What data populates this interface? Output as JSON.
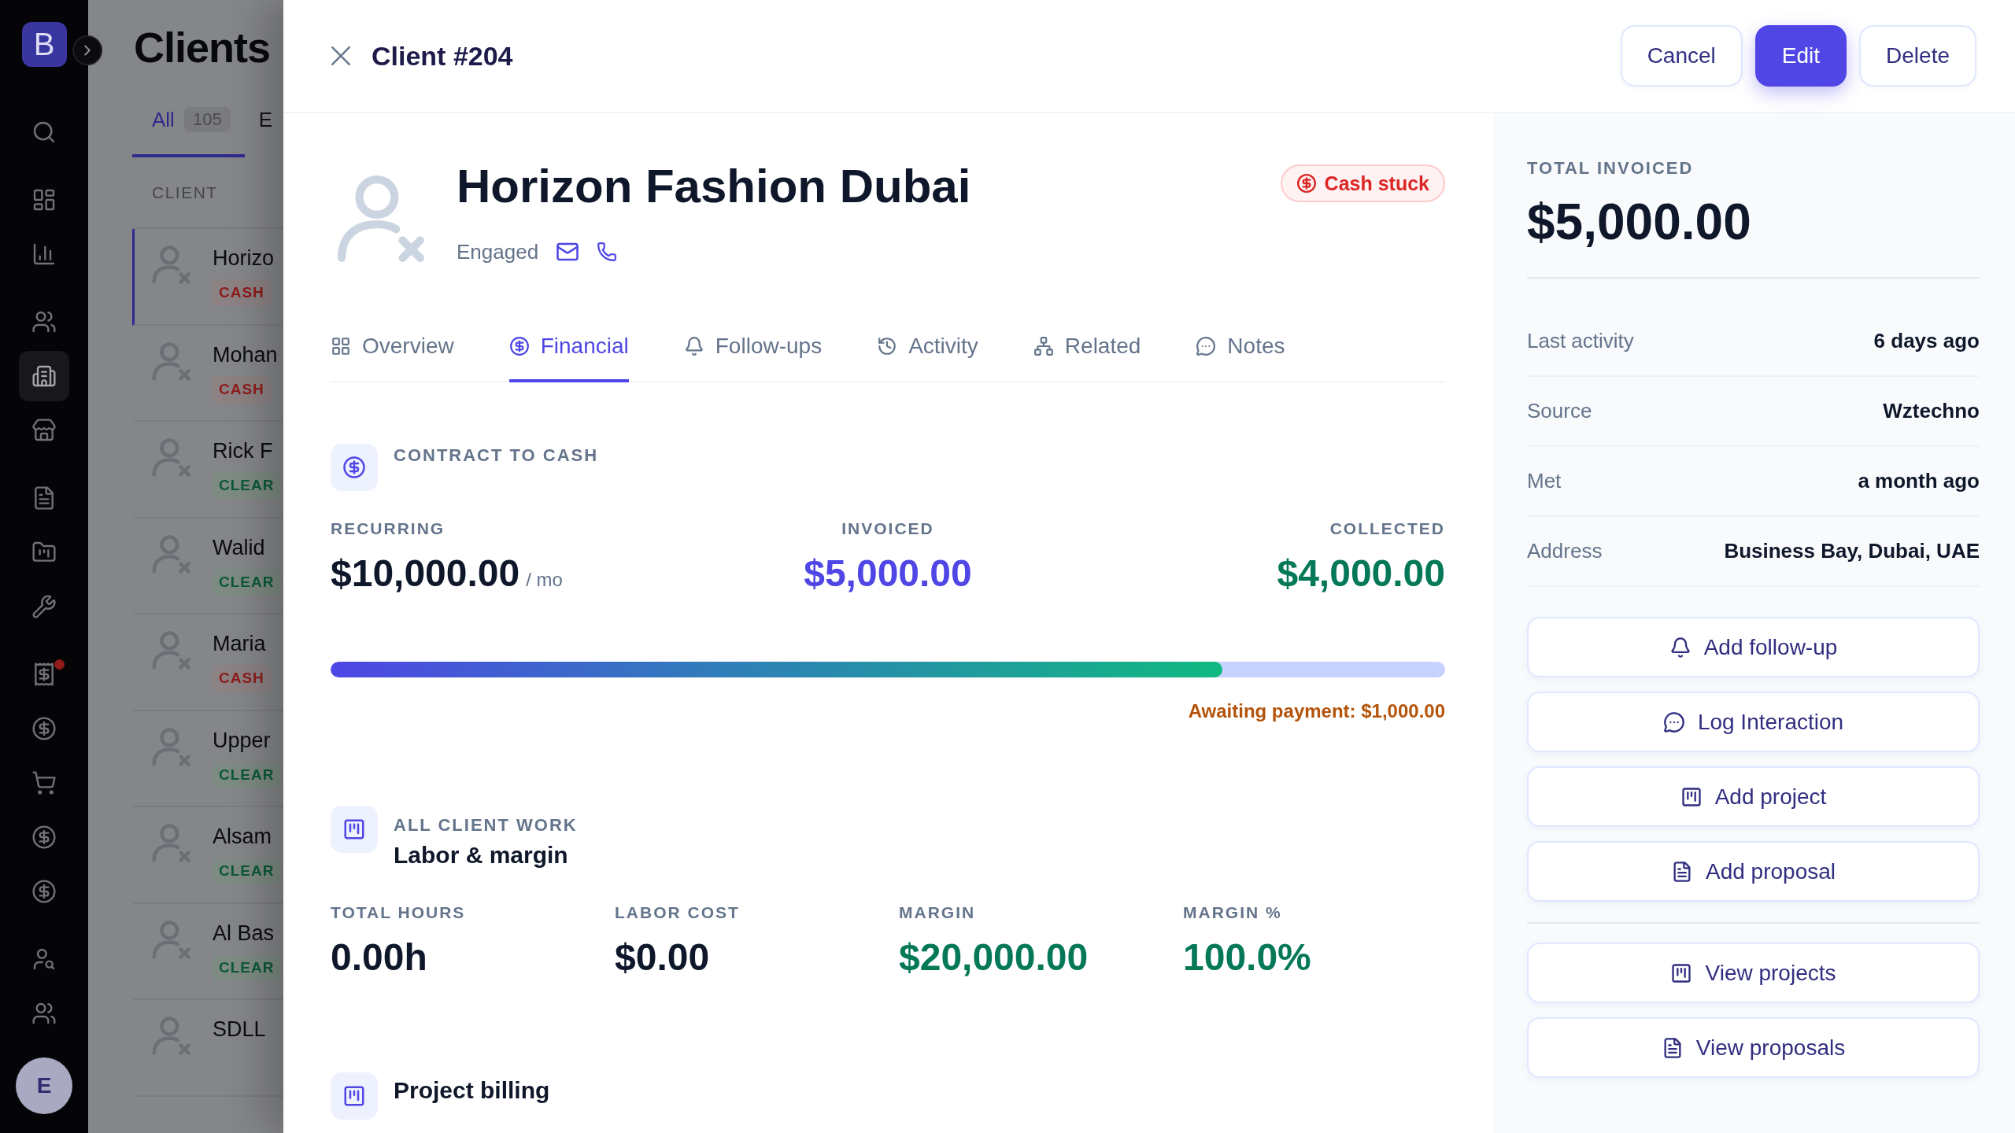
{
  "sidebar": {
    "logo": "B",
    "groups": [
      {
        "items": [
          {
            "selected": false,
            "alert": false
          }
        ]
      },
      {
        "items": [
          {
            "selected": false,
            "alert": false
          },
          {
            "selected": false,
            "alert": false
          }
        ]
      },
      {
        "items": [
          {
            "selected": false,
            "alert": false
          },
          {
            "selected": true,
            "alert": false
          },
          {
            "selected": false,
            "alert": false
          }
        ]
      },
      {
        "items": [
          {
            "selected": false,
            "alert": false
          },
          {
            "selected": false,
            "alert": false
          },
          {
            "selected": false,
            "alert": false
          }
        ]
      },
      {
        "items": [
          {
            "selected": false,
            "alert": true
          },
          {
            "selected": false,
            "alert": false
          },
          {
            "selected": false,
            "alert": false
          },
          {
            "selected": false,
            "alert": false
          },
          {
            "selected": false,
            "alert": false
          }
        ]
      },
      {
        "items": [
          {
            "selected": false,
            "alert": false
          },
          {
            "selected": false,
            "alert": false
          }
        ]
      }
    ],
    "user_initial": "E"
  },
  "client_list": {
    "title": "Clients",
    "tabs": [
      {
        "label": "All",
        "count": "105",
        "selected": true
      },
      {
        "label": "E",
        "selected": false
      }
    ],
    "column_header": "CLIENT",
    "rows": [
      {
        "name": "Horizo",
        "status": {
          "label": "CASH",
          "kind": "cash_stuck"
        },
        "selected": true
      },
      {
        "name": "Mohan",
        "status": {
          "label": "CASH",
          "kind": "cash_stuck"
        },
        "selected": false
      },
      {
        "name": "Rick F",
        "status": {
          "label": "CLEAR",
          "kind": "clear"
        },
        "selected": false
      },
      {
        "name": "Walid",
        "status": {
          "label": "CLEAR",
          "kind": "clear"
        },
        "selected": false
      },
      {
        "name": "Maria",
        "status": {
          "label": "CASH",
          "kind": "cash_stuck"
        },
        "selected": false
      },
      {
        "name": "Upper",
        "status": {
          "label": "CLEAR",
          "kind": "clear"
        },
        "selected": false
      },
      {
        "name": "Alsam",
        "status": {
          "label": "CLEAR",
          "kind": "clear"
        },
        "selected": false
      },
      {
        "name": "Al Bas",
        "status": {
          "label": "CLEAR",
          "kind": "clear"
        },
        "selected": false
      },
      {
        "name": "SDLL",
        "selected": false
      }
    ]
  },
  "drawer": {
    "title": "Client #204",
    "actions": [
      {
        "label": "Cancel",
        "kind": "secondary"
      },
      {
        "label": "Edit",
        "kind": "primary"
      },
      {
        "label": "Delete",
        "kind": "secondary"
      }
    ],
    "client": {
      "name": "Horizon Fashion Dubai",
      "stage": "Engaged",
      "badge": "Cash stuck"
    },
    "tabs": [
      {
        "label": "Overview",
        "selected": false
      },
      {
        "label": "Financial",
        "selected": true
      },
      {
        "label": "Follow-ups",
        "selected": false
      },
      {
        "label": "Activity",
        "selected": false
      },
      {
        "label": "Related",
        "selected": false
      },
      {
        "label": "Notes",
        "selected": false
      }
    ],
    "contract_to_cash": {
      "heading": "CONTRACT TO CASH",
      "metrics": [
        {
          "label": "RECURRING",
          "value": "$10,000.00",
          "unit": "/ mo",
          "color": "#0f172a"
        },
        {
          "label": "INVOICED",
          "value": "$5,000.00",
          "color": "#4f46e5"
        },
        {
          "label": "COLLECTED",
          "value": "$4,000.00",
          "color": "#047857"
        }
      ],
      "progress": {
        "level": 0.8
      },
      "note": "Awaiting payment: $1,000.00"
    },
    "labor": {
      "eyebrow": "ALL CLIENT WORK",
      "heading": "Labor & margin",
      "metrics": [
        {
          "label": "TOTAL HOURS",
          "value": "0.00h",
          "color": "#0f172a"
        },
        {
          "label": "LABOR COST",
          "value": "$0.00",
          "color": "#0f172a"
        },
        {
          "label": "MARGIN",
          "value": "$20,000.00",
          "color": "#047857"
        },
        {
          "label": "MARGIN %",
          "value": "100.0%",
          "color": "#047857"
        }
      ]
    },
    "project_billing": {
      "heading": "Project billing"
    },
    "summary": {
      "label": "TOTAL INVOICED",
      "value": "$5,000.00",
      "details": [
        {
          "label": "Last activity",
          "value": "6 days ago"
        },
        {
          "label": "Source",
          "value": "Wztechno"
        },
        {
          "label": "Met",
          "value": "a month ago"
        },
        {
          "label": "Address",
          "value": "Business Bay, Dubai, UAE"
        }
      ],
      "actions": [
        "Add follow-up",
        "Log Interaction",
        "Add project",
        "Add proposal"
      ],
      "links": [
        "View projects",
        "View proposals"
      ]
    }
  }
}
